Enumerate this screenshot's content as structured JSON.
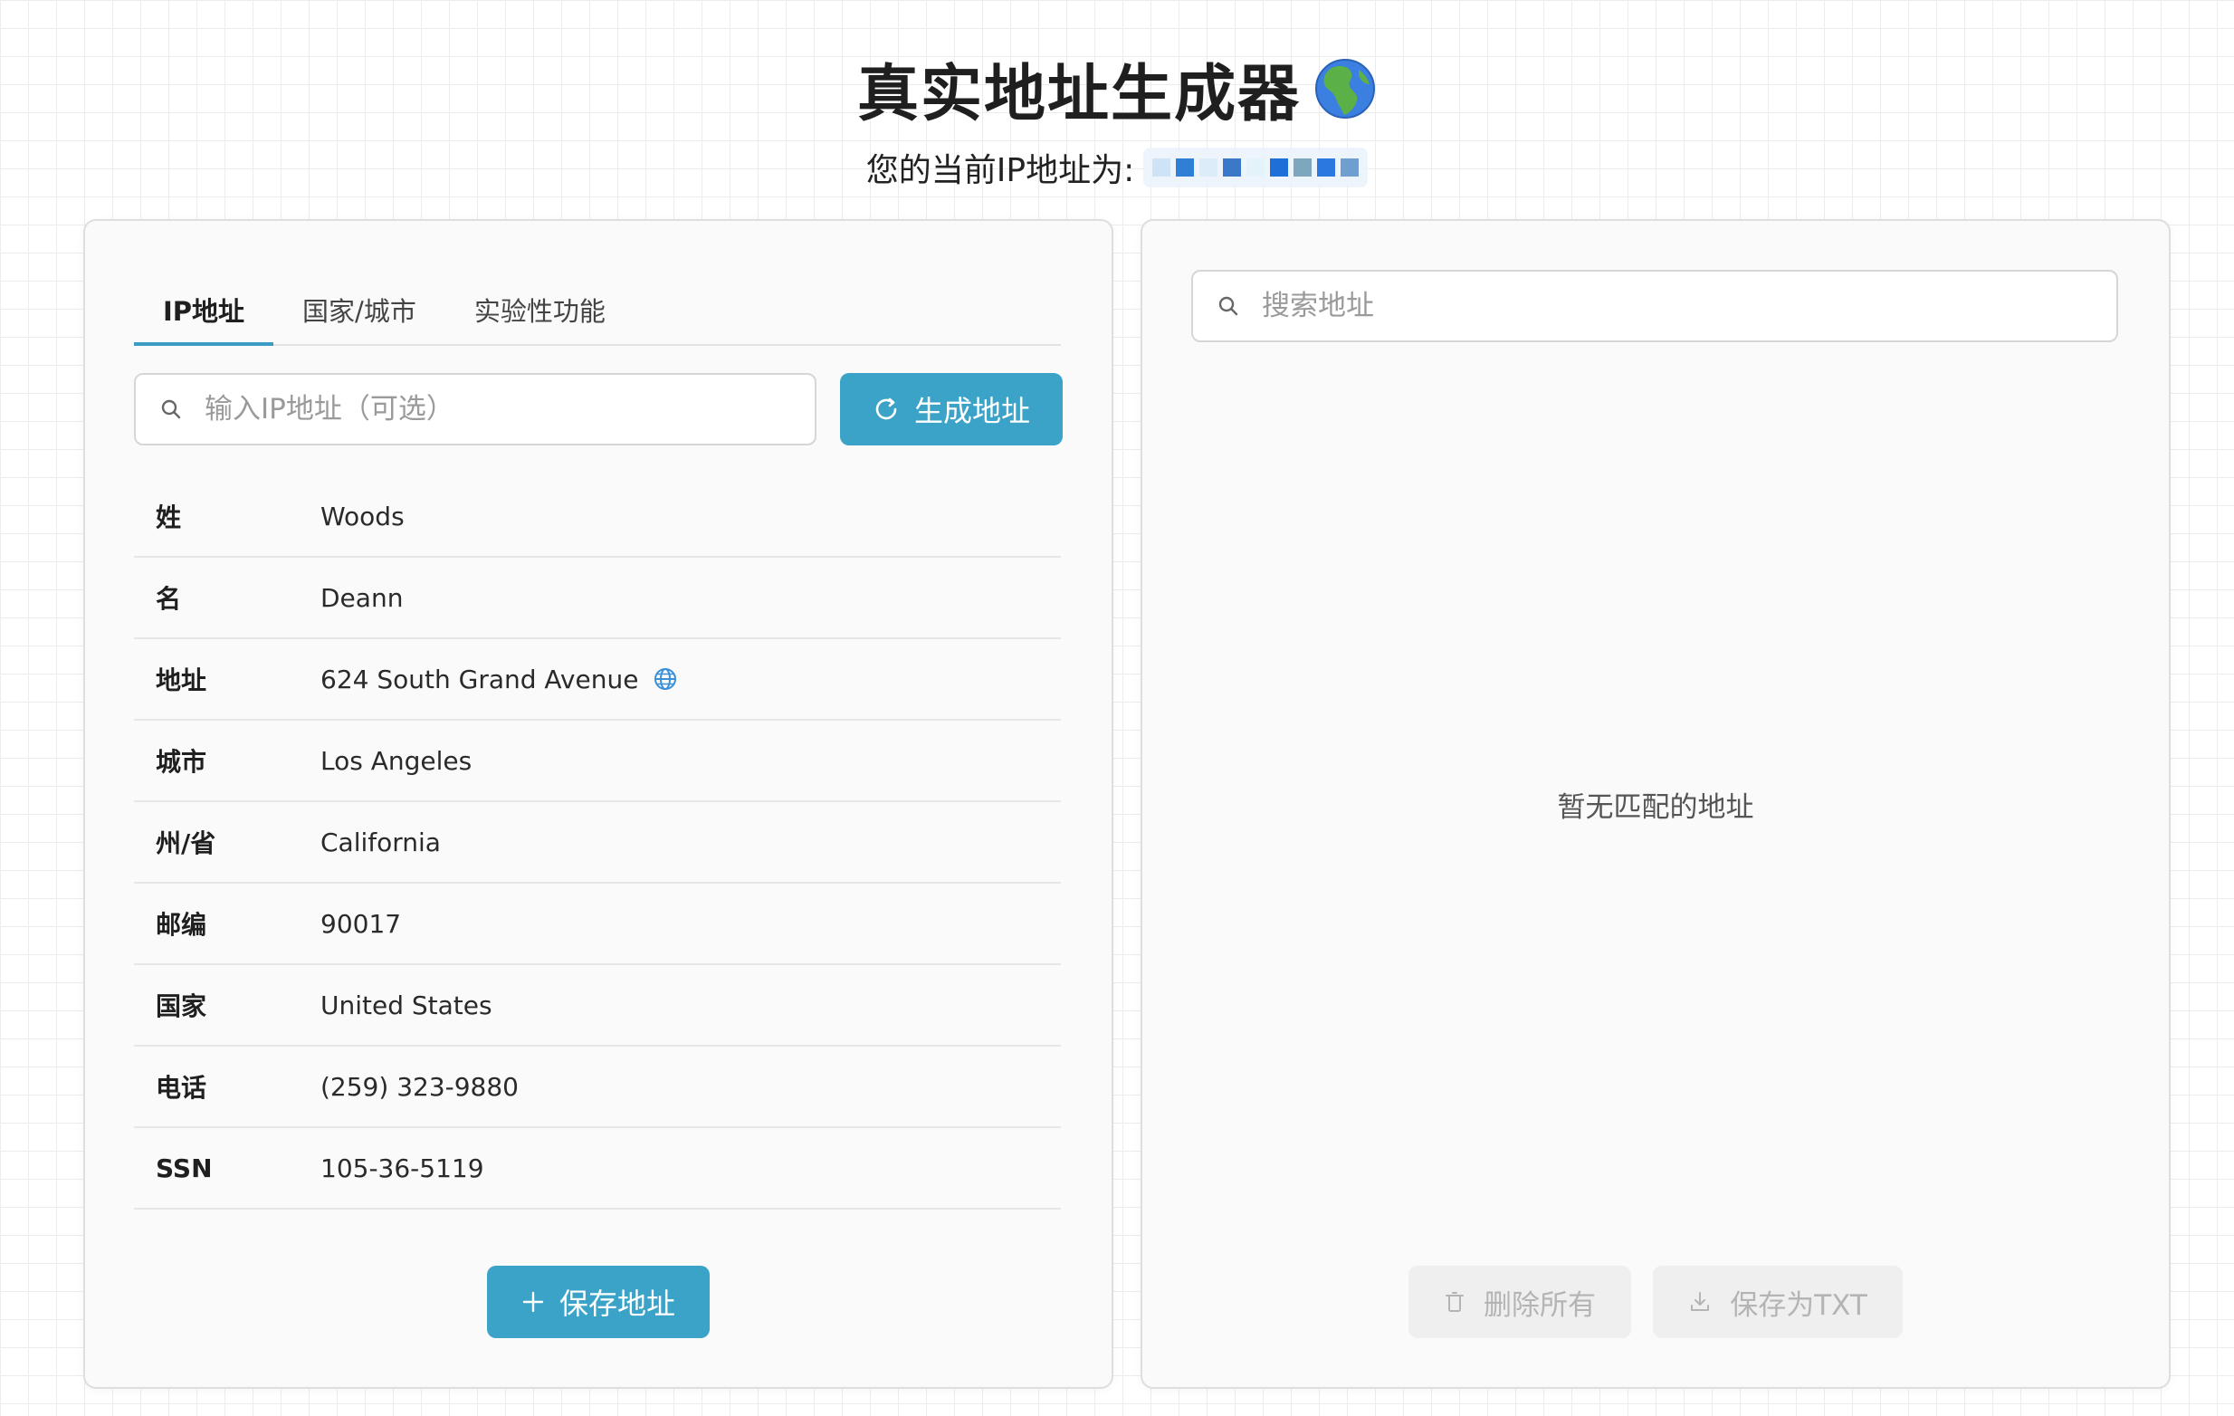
{
  "header": {
    "title": "真实地址生成器",
    "ip_label": "您的当前IP地址为:"
  },
  "tabs": [
    {
      "label": "IP地址",
      "active": true
    },
    {
      "label": "国家/城市",
      "active": false
    },
    {
      "label": "实验性功能",
      "active": false
    }
  ],
  "ip_input": {
    "placeholder": "输入IP地址（可选）",
    "value": ""
  },
  "generate_button": {
    "label": "生成地址"
  },
  "details": [
    {
      "label": "姓",
      "value": "Woods"
    },
    {
      "label": "名",
      "value": "Deann"
    },
    {
      "label": "地址",
      "value": "624 South Grand Avenue"
    },
    {
      "label": "城市",
      "value": "Los Angeles"
    },
    {
      "label": "州/省",
      "value": "California"
    },
    {
      "label": "邮编",
      "value": "90017"
    },
    {
      "label": "国家",
      "value": "United States"
    },
    {
      "label": "电话",
      "value": "(259) 323-9880"
    },
    {
      "label": "SSN",
      "value": "105-36-5119"
    }
  ],
  "save_button": {
    "label": "保存地址"
  },
  "search": {
    "placeholder": "搜索地址",
    "value": ""
  },
  "empty_message": "暂无匹配的地址",
  "delete_all_button": {
    "label": "删除所有"
  },
  "save_txt_button": {
    "label": "保存为TXT"
  },
  "colors": {
    "accent": "#3ba3c8",
    "disabled_bg": "#efefef",
    "disabled_text": "#b4b4b4"
  },
  "icons": [
    "globe-emoji-icon",
    "search-icon",
    "refresh-icon",
    "globe-icon",
    "plus-icon",
    "trash-icon",
    "download-icon"
  ]
}
